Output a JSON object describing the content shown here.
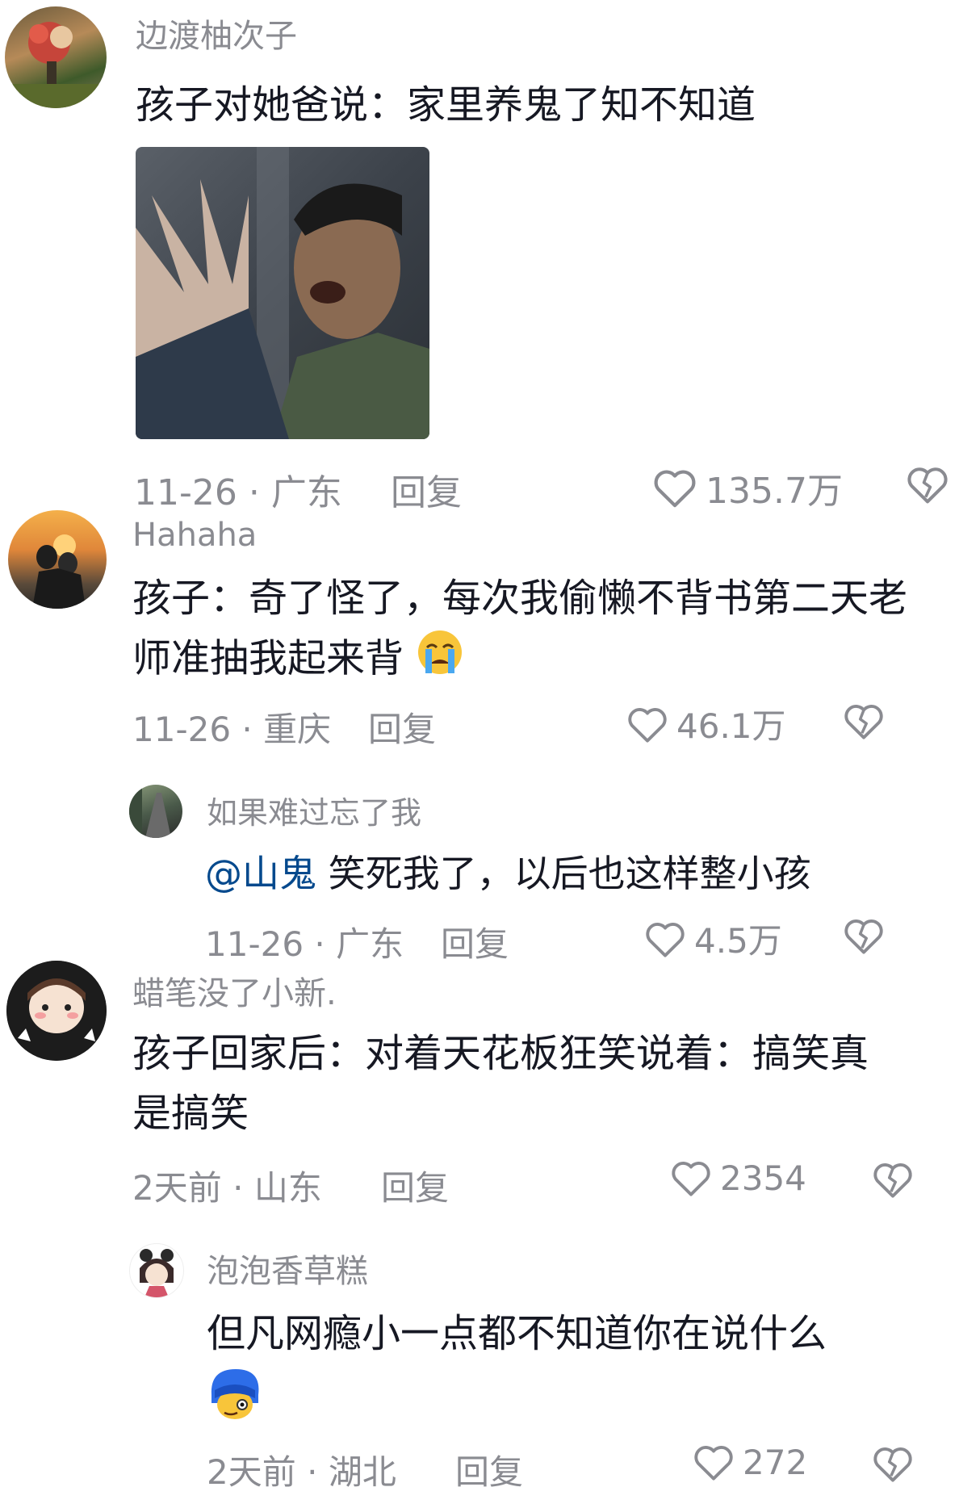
{
  "comments": [
    {
      "username": "边渡柚次子",
      "text": "孩子对她爸说：家里养鬼了知不知道",
      "date": "11-26",
      "location": "广东",
      "reply_label": "回复",
      "likes": "135.7万"
    },
    {
      "username": "Hahaha",
      "text": "孩子：奇了怪了，每次我偷懒不背书第二天老师准抽我起来背",
      "date": "11-26",
      "location": "重庆",
      "reply_label": "回复",
      "likes": "46.1万"
    },
    {
      "username": "如果难过忘了我",
      "mention": "@山鬼",
      "text": "笑死我了，以后也这样整小孩",
      "date": "11-26",
      "location": "广东",
      "reply_label": "回复",
      "likes": "4.5万"
    },
    {
      "username": "蜡笔没了小新.",
      "text": "孩子回家后：对着天花板狂笑说着：搞笑真是搞笑",
      "date": "2天前",
      "location": "山东",
      "reply_label": "回复",
      "likes": "2354"
    },
    {
      "username": "泡泡香草糕",
      "text": "但凡网瘾小一点都不知道你在说什么",
      "date": "2天前",
      "location": "湖北",
      "reply_label": "回复",
      "likes": "272"
    }
  ],
  "meta_separator": "·",
  "icons": {
    "like": "heart-outline-icon",
    "dislike": "broken-heart-icon",
    "emoji_crying": "crying-face-emoji",
    "emoji_mask": "blue-hair-sticker-emoji"
  },
  "colors": {
    "text": "#161823",
    "secondary": "#8a8b91",
    "mention": "#04498d"
  }
}
